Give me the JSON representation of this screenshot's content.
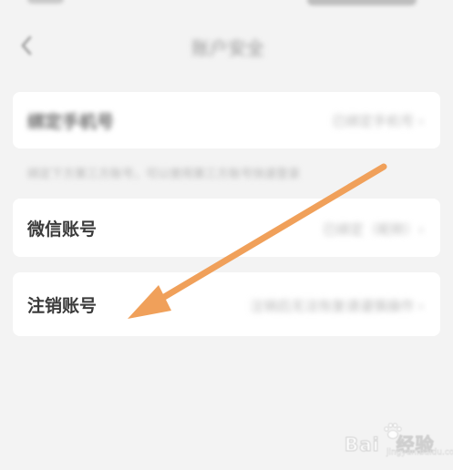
{
  "status_bar": {
    "time": "",
    "icons": ""
  },
  "nav": {
    "back_icon": "chevron-left-icon",
    "title": "账户安全"
  },
  "rows": {
    "phone": {
      "label": "绑定手机号",
      "value": "已绑定手机号 ›"
    },
    "hint": "绑定下方第三方账号，可以使用第三方账号快速登录",
    "wechat": {
      "label": "微信账号",
      "value": "已绑定（昵称）›"
    },
    "cancel": {
      "label": "注销账号",
      "value": "注销后无法恢复请谨慎操作 ›"
    }
  },
  "overlay": {
    "arrow_color": "#f0a05a"
  },
  "watermark": {
    "brand": "Bai",
    "brand_suffix": "经验",
    "sub": "jingyan.baidu.com"
  }
}
